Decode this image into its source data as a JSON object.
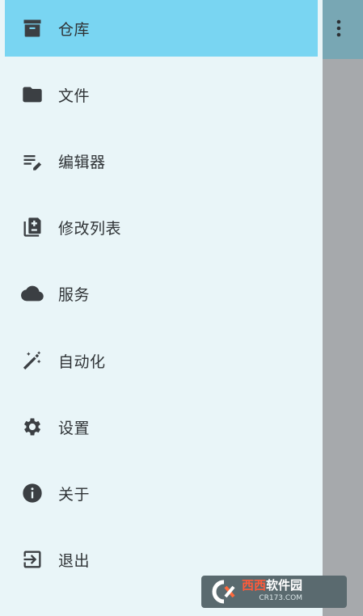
{
  "drawer": {
    "items": [
      {
        "label": "仓库",
        "icon": "archive-icon",
        "active": true
      },
      {
        "label": "文件",
        "icon": "folder-icon",
        "active": false
      },
      {
        "label": "编辑器",
        "icon": "edit-note-icon",
        "active": false
      },
      {
        "label": "修改列表",
        "icon": "diff-icon",
        "active": false
      },
      {
        "label": "服务",
        "icon": "cloud-icon",
        "active": false
      },
      {
        "label": "自动化",
        "icon": "magic-wand-icon",
        "active": false
      },
      {
        "label": "设置",
        "icon": "gear-icon",
        "active": false
      },
      {
        "label": "关于",
        "icon": "info-icon",
        "active": false
      },
      {
        "label": "退出",
        "icon": "exit-icon",
        "active": false
      }
    ]
  },
  "colors": {
    "drawer_bg": "#e9f5f8",
    "active_bg": "#79d5f2",
    "scrim": "#a6a9ac",
    "scrim_topbar": "#78a7b4"
  },
  "watermark": {
    "brand_a": "西西",
    "brand_b": "软件园",
    "domain": "CR173.COM"
  }
}
